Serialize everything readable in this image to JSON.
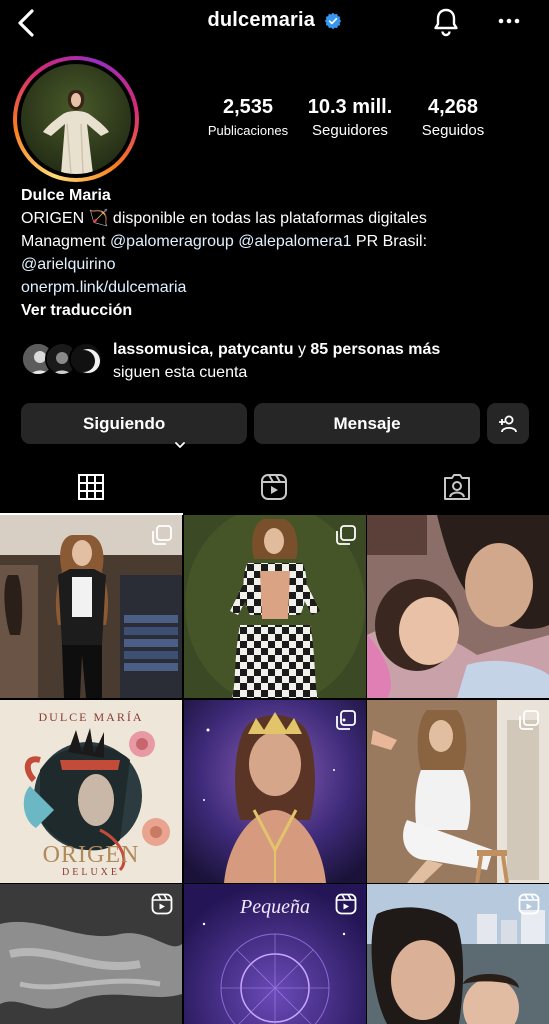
{
  "header": {
    "username": "dulcemaria",
    "icons": {
      "back": "chevron-left-icon",
      "verified": "verified-badge-icon",
      "notifications": "bell-icon",
      "more": "more-horizontal-icon"
    }
  },
  "profile": {
    "stats": [
      {
        "value": "2,535",
        "label": "Publicaciones"
      },
      {
        "value": "10.3 mill.",
        "label": "Seguidores"
      },
      {
        "value": "4,268",
        "label": "Seguidos"
      }
    ],
    "name": "Dulce Maria",
    "bio": {
      "line1": "ORIGEN 🏹 disponible en todas las plataformas digitales",
      "line2_prefix": "Managment ",
      "mention1": "@palomeragroup",
      "mention2": "@alepalomera1",
      "line2_suffix": " PR Brasil:",
      "mention3": "@arielquirino",
      "link": "onerpm.link/dulcemaria",
      "translate": "Ver traducción"
    },
    "followed_by": {
      "names": "lassomusica, patycantu",
      "connector": " y ",
      "others": "85 personas más",
      "suffix": "siguen esta cuenta"
    }
  },
  "actions": {
    "following": "Siguiendo",
    "message": "Mensaje",
    "add_icon": "add-person-icon"
  },
  "tabs": [
    {
      "name": "grid",
      "icon": "grid-icon",
      "active": true
    },
    {
      "name": "reels",
      "icon": "reels-icon",
      "active": false
    },
    {
      "name": "tagged",
      "icon": "tagged-person-icon",
      "active": false
    }
  ],
  "posts": [
    {
      "type": "carousel",
      "caption": ""
    },
    {
      "type": "carousel",
      "caption": ""
    },
    {
      "type": "photo",
      "caption": ""
    },
    {
      "type": "photo",
      "title": "DULCE MARÍA",
      "album": "ORIGEN",
      "edition": "DELUXE"
    },
    {
      "type": "carousel",
      "caption": ""
    },
    {
      "type": "carousel",
      "caption": ""
    },
    {
      "type": "reel",
      "caption": ""
    },
    {
      "type": "reel",
      "script": "Pequeña"
    },
    {
      "type": "reel",
      "caption": ""
    }
  ],
  "colors": {
    "background": "#000000",
    "button": "#262626",
    "verified": "#3797f0",
    "link": "#e0f1ff"
  }
}
